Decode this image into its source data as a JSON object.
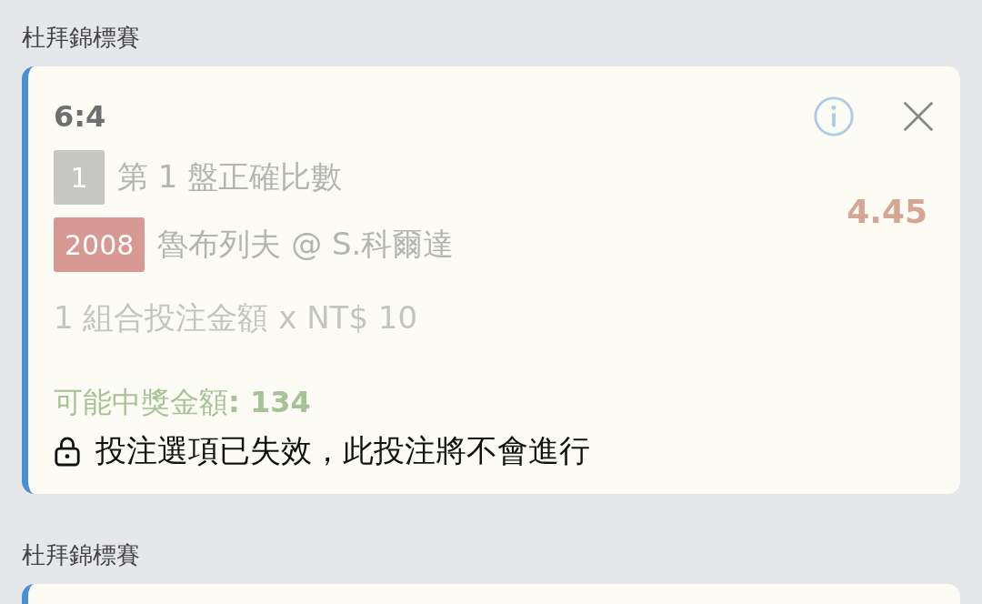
{
  "sections": [
    {
      "title": "杜拜錦標賽",
      "bet": {
        "score": "6:4",
        "locked": true,
        "odds": "4.45",
        "lines": [
          {
            "badge": "1",
            "color": "#c6c6c2",
            "text": "第 1 盤正確比數"
          },
          {
            "badge": "2008",
            "color": "#d89994",
            "text": "魯布列夫 @ S.科爾達"
          }
        ],
        "stake": "1 組合投注金額 x NT$ 10",
        "payout": "可能中獎金額**: 134**",
        "notice": "投注選項已失效，此投注將不會進行"
      }
    },
    {
      "title": "杜拜錦標賽"
    }
  ]
}
